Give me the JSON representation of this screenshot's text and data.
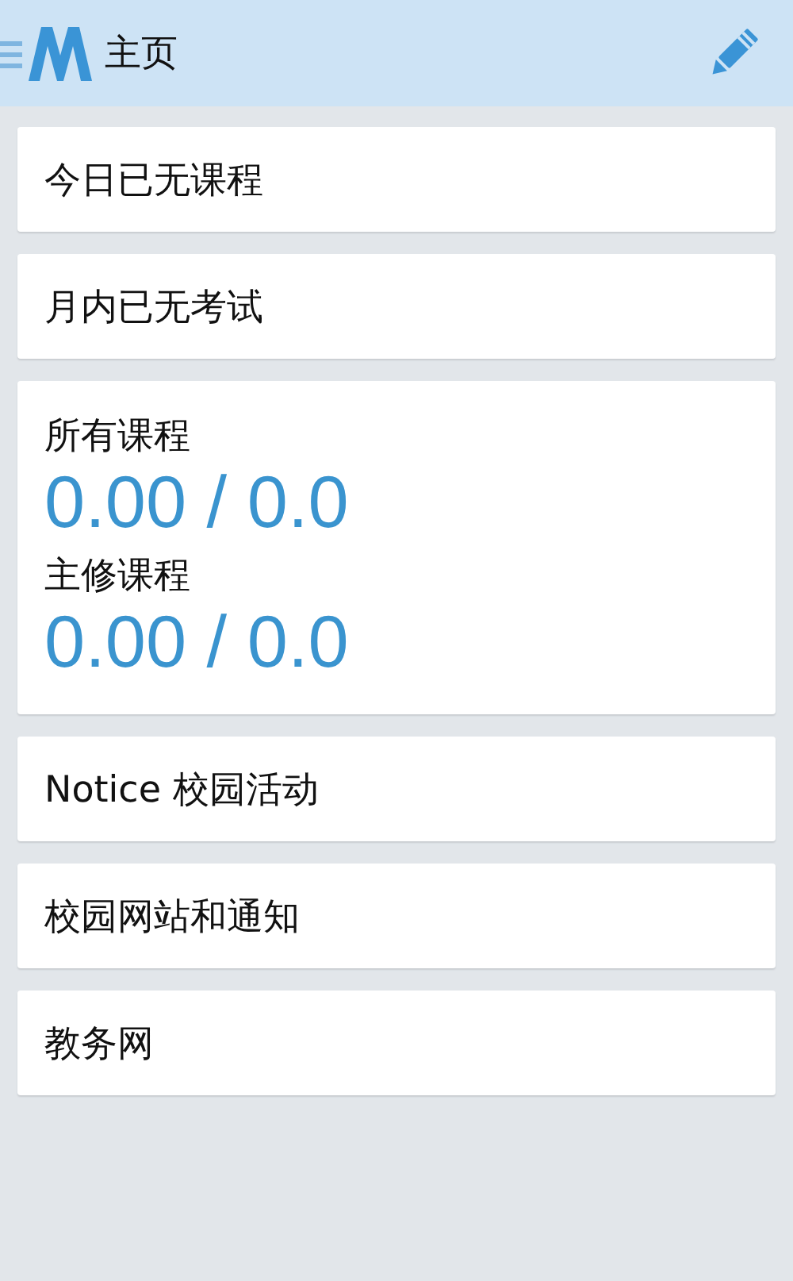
{
  "header": {
    "title": "主页"
  },
  "cards": [
    {
      "kind": "text",
      "label": "今日已无课程"
    },
    {
      "kind": "text",
      "label": "月内已无考试"
    },
    {
      "kind": "gpa",
      "groups": [
        {
          "label": "所有课程",
          "value": "0.00 / 0.0"
        },
        {
          "label": "主修课程",
          "value": "0.00 / 0.0"
        }
      ]
    },
    {
      "kind": "text",
      "label": "Notice 校园活动"
    },
    {
      "kind": "text",
      "label": "校园网站和通知"
    },
    {
      "kind": "text",
      "label": "教务网"
    }
  ]
}
